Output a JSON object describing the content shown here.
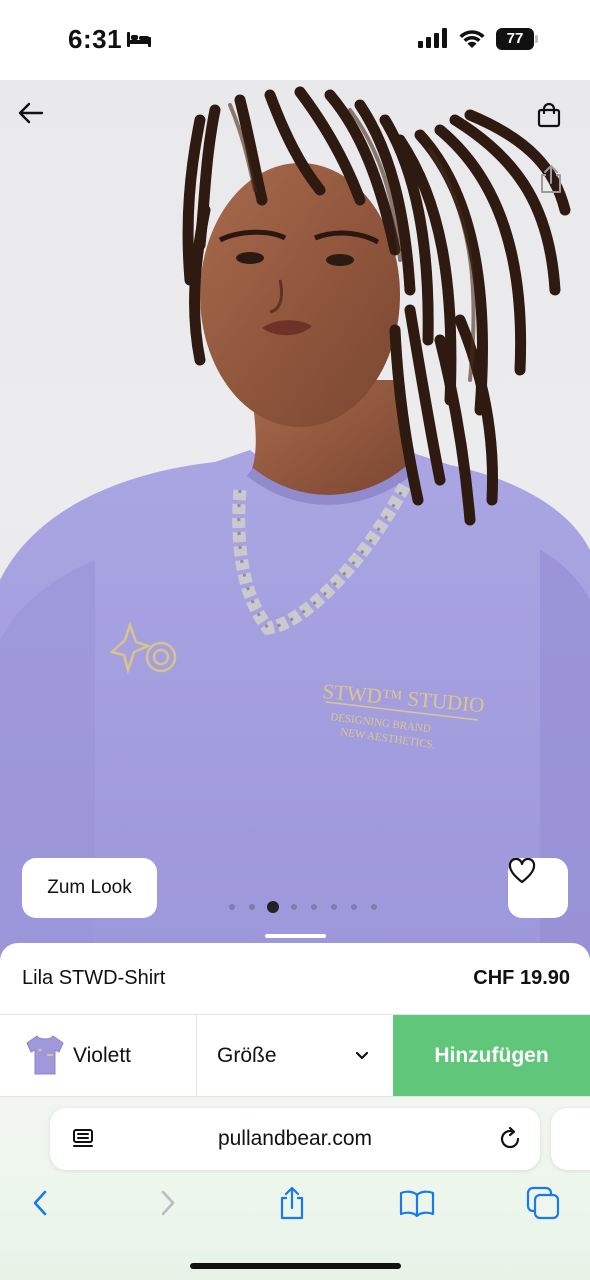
{
  "status_bar": {
    "time": "6:31",
    "battery": "77",
    "sleep_icon": "bed-icon",
    "signal_icon": "cellular-signal-icon",
    "wifi_icon": "wifi-icon"
  },
  "hero": {
    "look_button": "Zum Look",
    "back_icon": "arrow-left-icon",
    "bag_icon": "shopping-bag-icon",
    "share_icon": "share-icon",
    "favorite_icon": "heart-icon",
    "carousel": {
      "total": 8,
      "active_index": 2
    },
    "shirt_print_lines": [
      "STWD™ STUDIO",
      "DESIGNING BRAND",
      "NEW AESTHETICS."
    ]
  },
  "product": {
    "name": "Lila STWD-Shirt",
    "price": "CHF 19.90",
    "color_label": "Violett",
    "size_label": "Größe",
    "add_label": "Hinzufügen"
  },
  "browser": {
    "url": "pullandbear.com",
    "toolbar_icons": [
      "chevron-left-icon",
      "chevron-right-icon",
      "share-icon",
      "book-icon",
      "tabs-icon"
    ]
  },
  "colors": {
    "add_button": "#5fc67a",
    "safari_accent": "#1a7ae8",
    "shirt": "#a7a2e0"
  }
}
